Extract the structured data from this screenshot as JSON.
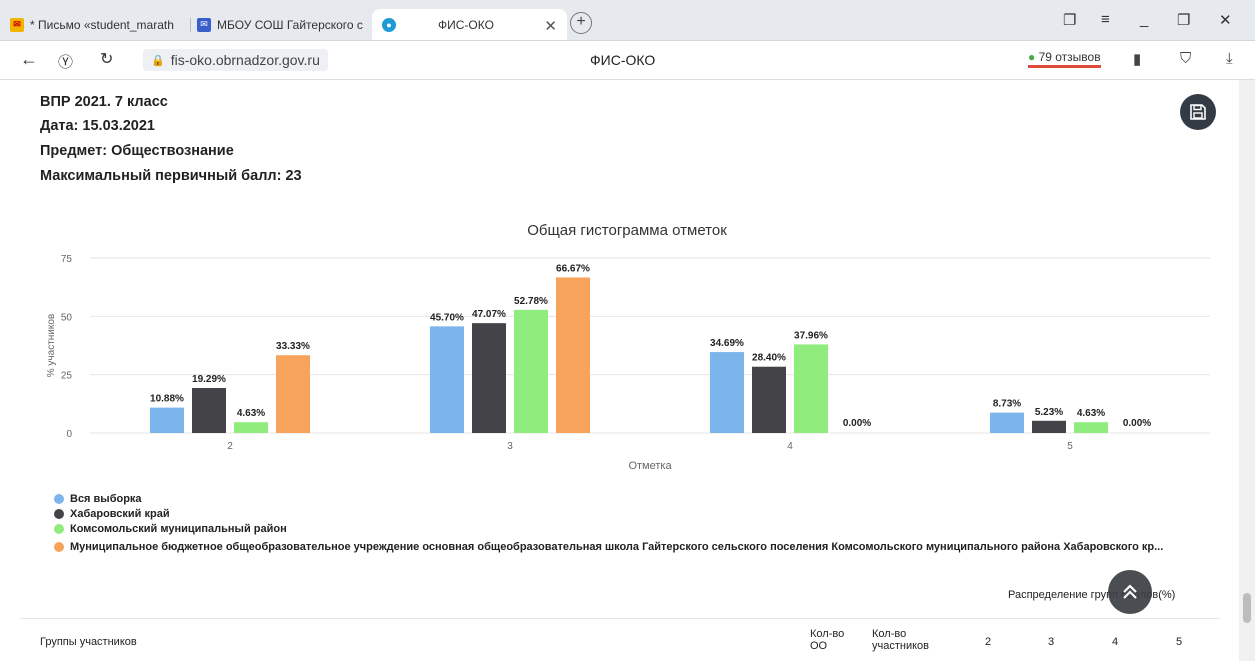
{
  "browser": {
    "tabs": [
      {
        "title": "* Письмо «student_marath",
        "icon": "mail-icon"
      },
      {
        "title": "МБОУ СОШ Гайтерского с",
        "icon": "mail-envelope-icon"
      },
      {
        "title": "ФИС-ОКО",
        "icon": "site-icon"
      }
    ],
    "url": "fis-oko.obrnadzor.gov.ru",
    "page_title": "ФИС-ОКО",
    "reviews": "79 отзывов"
  },
  "info": {
    "line1": "ВПР 2021. 7 класс",
    "line2": "Дата: 15.03.2021",
    "line3": "Предмет: Обществознание",
    "line4": "Максимальный первичный балл: 23"
  },
  "chart_data": {
    "type": "bar",
    "title": "Общая гистограмма отметок",
    "xlabel": "Отметка",
    "ylabel": "% участников",
    "ylim": [
      0,
      75
    ],
    "yticks": [
      0,
      25,
      50,
      75
    ],
    "categories": [
      "2",
      "3",
      "4",
      "5"
    ],
    "grid": true,
    "legend_position": "bottom-left",
    "series": [
      {
        "name": "Вся выборка",
        "color": "#7cb5ec",
        "values": [
          10.88,
          45.7,
          34.69,
          8.73
        ],
        "labels": [
          "10.88%",
          "45.70%",
          "34.69%",
          "8.73%"
        ]
      },
      {
        "name": "Хабаровский край",
        "color": "#434348",
        "values": [
          19.29,
          47.07,
          28.4,
          5.23
        ],
        "labels": [
          "19.29%",
          "47.07%",
          "28.40%",
          "5.23%"
        ]
      },
      {
        "name": "Комсомольский муниципальный район",
        "color": "#90ed7d",
        "values": [
          4.63,
          52.78,
          37.96,
          4.63
        ],
        "labels": [
          "4.63%",
          "52.78%",
          "37.96%",
          "4.63%"
        ]
      },
      {
        "name": "Муниципальное бюджетное общеобразовательное учреждение основная общеобразовательная школа Гайтерского сельского поселения Комсомольского муниципального района Хабаровского кр...",
        "color": "#f7a35c",
        "values": [
          33.33,
          66.67,
          0.0,
          0.0
        ],
        "labels": [
          "33.33%",
          "66.67%",
          "0.00%",
          "0.00%"
        ]
      }
    ]
  },
  "section": {
    "distribution_label": "Распределение групп баллов(%)"
  },
  "table_header": {
    "col_groups": "Группы участников",
    "col_oo": "Кол-во ОО",
    "col_participants": "Кол-во участников",
    "grade_cols": [
      "2",
      "3",
      "4",
      "5"
    ]
  }
}
